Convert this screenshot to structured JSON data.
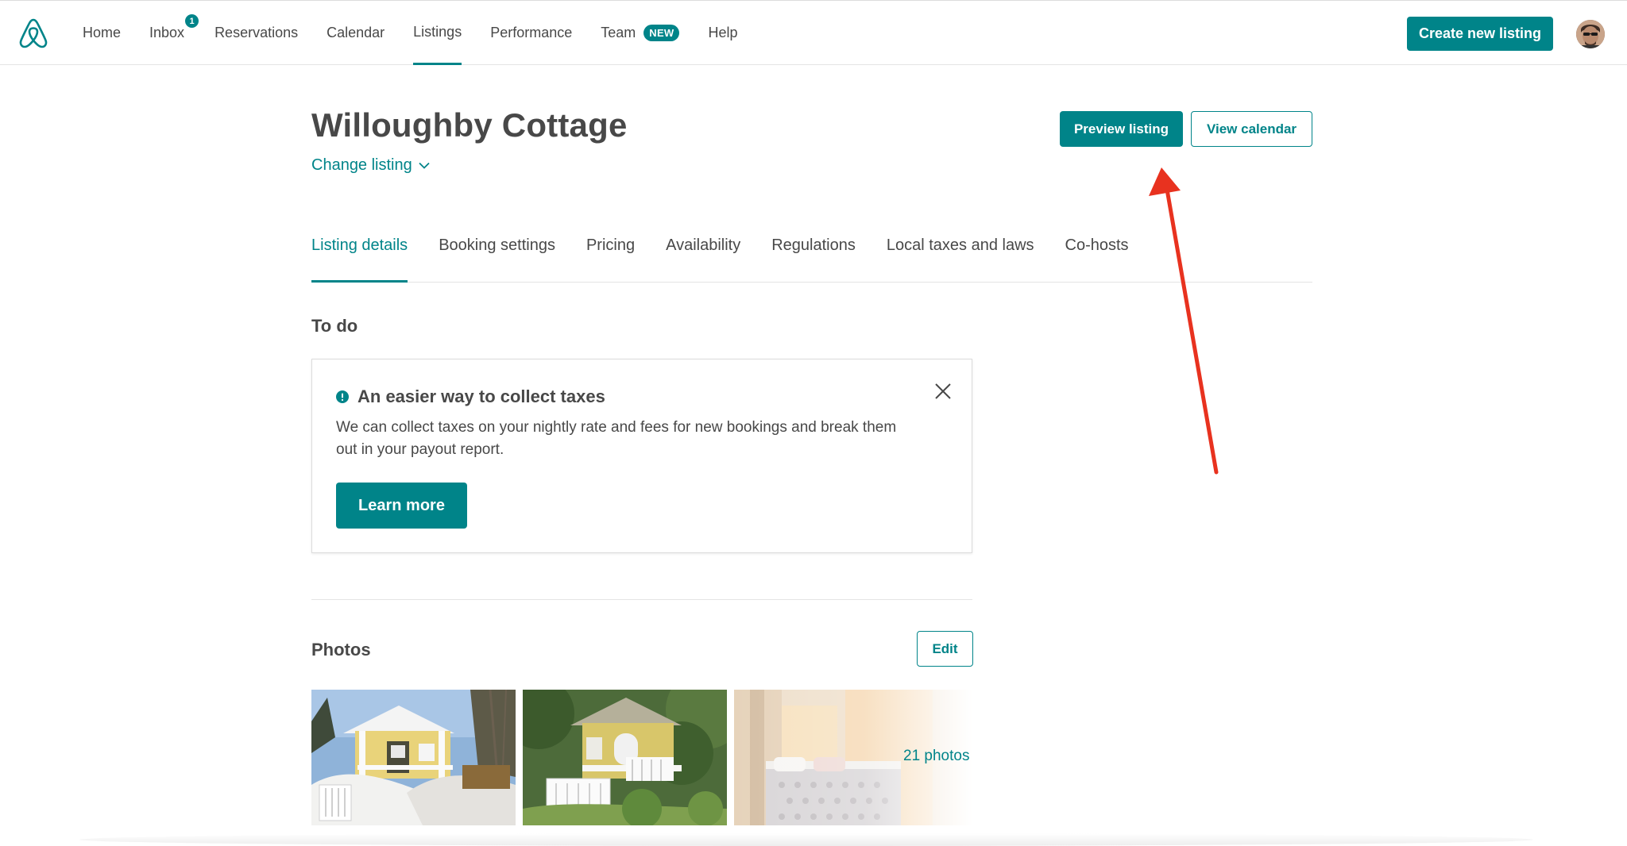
{
  "nav": {
    "items": [
      {
        "label": "Home"
      },
      {
        "label": "Inbox",
        "badge": "1"
      },
      {
        "label": "Reservations"
      },
      {
        "label": "Calendar"
      },
      {
        "label": "Listings",
        "active": true
      },
      {
        "label": "Performance"
      },
      {
        "label": "Team",
        "new_badge": "NEW"
      },
      {
        "label": "Help"
      }
    ],
    "create_label": "Create new listing"
  },
  "header": {
    "title": "Willoughby Cottage",
    "change_label": "Change listing",
    "preview_label": "Preview listing",
    "calendar_label": "View calendar"
  },
  "tabs": [
    {
      "label": "Listing details",
      "active": true
    },
    {
      "label": "Booking settings"
    },
    {
      "label": "Pricing"
    },
    {
      "label": "Availability"
    },
    {
      "label": "Regulations"
    },
    {
      "label": "Local taxes and laws"
    },
    {
      "label": "Co-hosts"
    }
  ],
  "todo": {
    "heading": "To do",
    "card_title": "An easier way to collect taxes",
    "card_body": "We can collect taxes on your nightly rate and fees for new bookings and break them out in your payout report.",
    "learn_label": "Learn more"
  },
  "photos": {
    "heading": "Photos",
    "edit_label": "Edit",
    "count_label": "21 photos"
  },
  "colors": {
    "accent": "#008489",
    "text": "#484848",
    "annotation": "#e8321f"
  }
}
